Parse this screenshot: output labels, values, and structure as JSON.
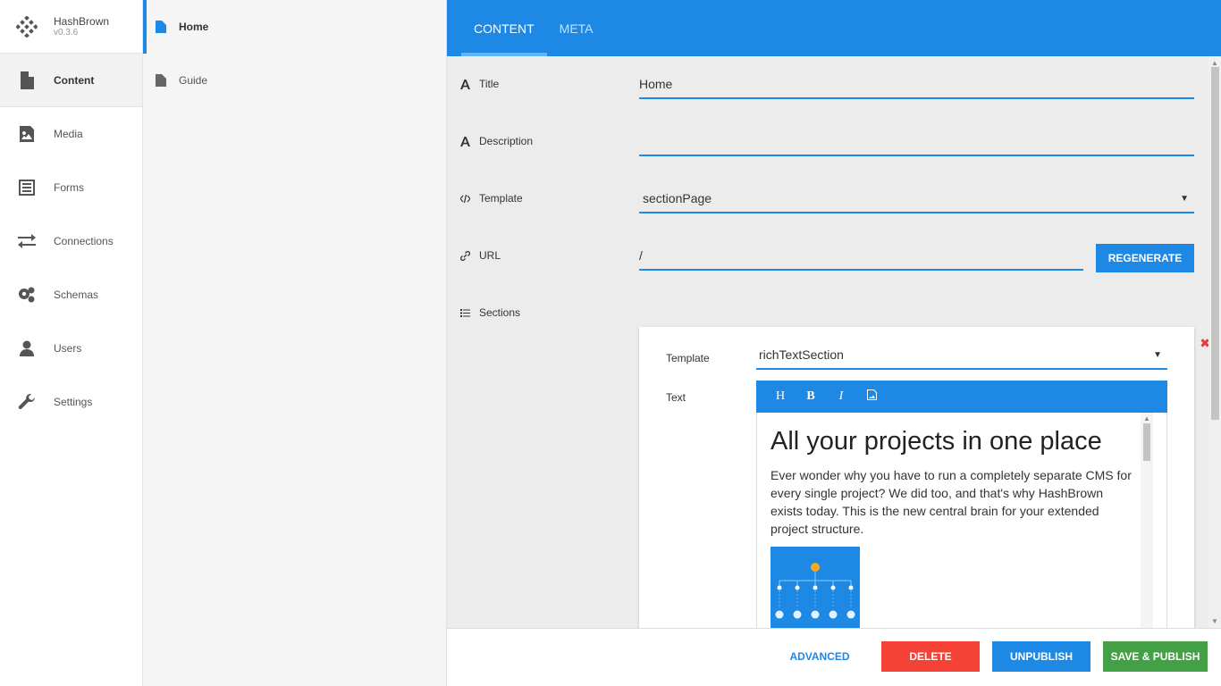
{
  "brand": {
    "name": "HashBrown",
    "version": "v0.3.6"
  },
  "mainnav": [
    {
      "label": "Content",
      "icon": "file-icon",
      "active": true
    },
    {
      "label": "Media",
      "icon": "image-icon"
    },
    {
      "label": "Forms",
      "icon": "form-icon"
    },
    {
      "label": "Connections",
      "icon": "exchange-icon"
    },
    {
      "label": "Schemas",
      "icon": "cogs-icon"
    },
    {
      "label": "Users",
      "icon": "user-icon"
    },
    {
      "label": "Settings",
      "icon": "wrench-icon"
    }
  ],
  "tree": [
    {
      "label": "Home",
      "active": true
    },
    {
      "label": "Guide"
    }
  ],
  "tabs": [
    {
      "label": "CONTENT",
      "active": true
    },
    {
      "label": "META"
    }
  ],
  "fields": {
    "title": {
      "label": "Title",
      "value": "Home"
    },
    "description": {
      "label": "Description",
      "value": ""
    },
    "template": {
      "label": "Template",
      "value": "sectionPage"
    },
    "url": {
      "label": "URL",
      "value": "/"
    },
    "regenerate": "REGENERATE",
    "sections": {
      "label": "Sections"
    }
  },
  "section": {
    "template_label": "Template",
    "template_value": "richTextSection",
    "text_label": "Text",
    "toolbar": [
      "H",
      "B",
      "I"
    ],
    "heading": "All your projects in one place",
    "paragraph": "Ever wonder why you have to run a completely separate CMS for every single project? We did too, and that's why HashBrown exists today. This is the new central brain for your extended project structure."
  },
  "footer": {
    "advanced": "ADVANCED",
    "delete": "DELETE",
    "unpublish": "UNPUBLISH",
    "save_publish": "SAVE & PUBLISH"
  },
  "colors": {
    "accent": "#1e88e5",
    "delete": "#f44336",
    "publish": "#43a047"
  }
}
